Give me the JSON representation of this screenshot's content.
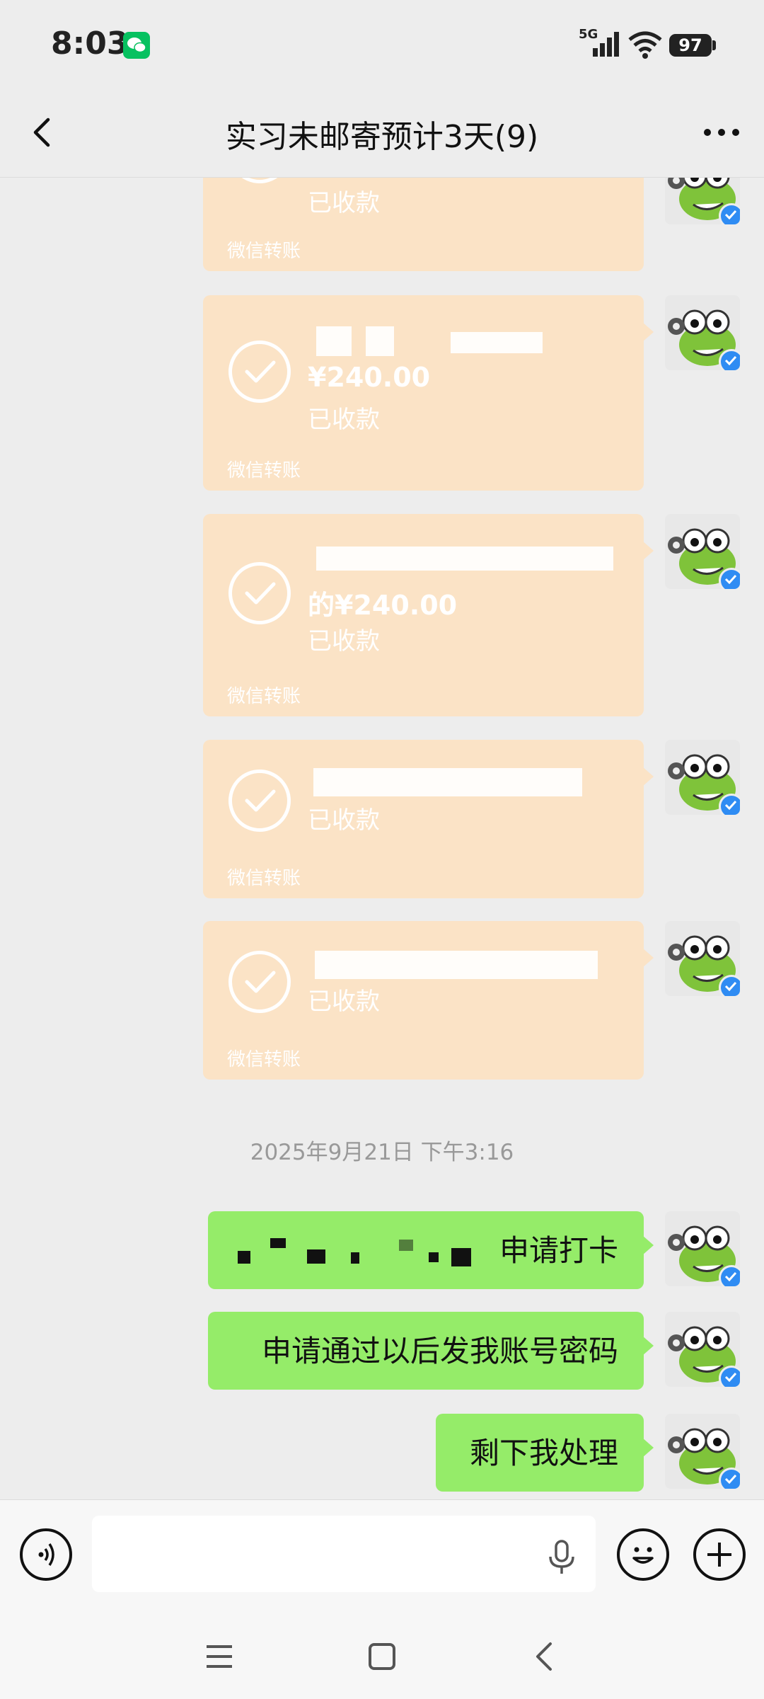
{
  "status_bar": {
    "time": "8:03",
    "network": "5G",
    "battery": "97"
  },
  "header": {
    "title": "实习未邮寄预计3天(9)"
  },
  "transfers": [
    {
      "amount": "",
      "status": "已收款",
      "footer": "微信转账"
    },
    {
      "amount": "¥240.00",
      "status": "已收款",
      "footer": "微信转账"
    },
    {
      "amount": "的¥240.00",
      "status": "已收款",
      "footer": "微信转账"
    },
    {
      "amount": "",
      "status": "已收款",
      "footer": "微信转账"
    },
    {
      "amount": "",
      "status": "已收款",
      "footer": "微信转账"
    }
  ],
  "timestamp": "2025年9月21日 下午3:16",
  "messages": [
    {
      "text": "申请打卡"
    },
    {
      "text": "申请通过以后发我账号密码"
    },
    {
      "text": "剩下我处理"
    }
  ],
  "input": {
    "placeholder": "",
    "value": ""
  },
  "colors": {
    "background": "#EDEDED",
    "transfer_card": "#FBE3C6",
    "sent_bubble": "#95EC69",
    "wechat_green": "#07C160",
    "verified_badge": "#2F8CF3"
  },
  "icons": [
    "wechat-icon",
    "signal-icon",
    "wifi-icon",
    "battery-icon",
    "back-arrow-icon",
    "more-icon",
    "check-circle-icon",
    "frog-avatar",
    "verified-icon",
    "voice-icon",
    "mic-icon",
    "emoji-icon",
    "plus-icon",
    "menu-icon",
    "home-icon",
    "back-icon"
  ]
}
